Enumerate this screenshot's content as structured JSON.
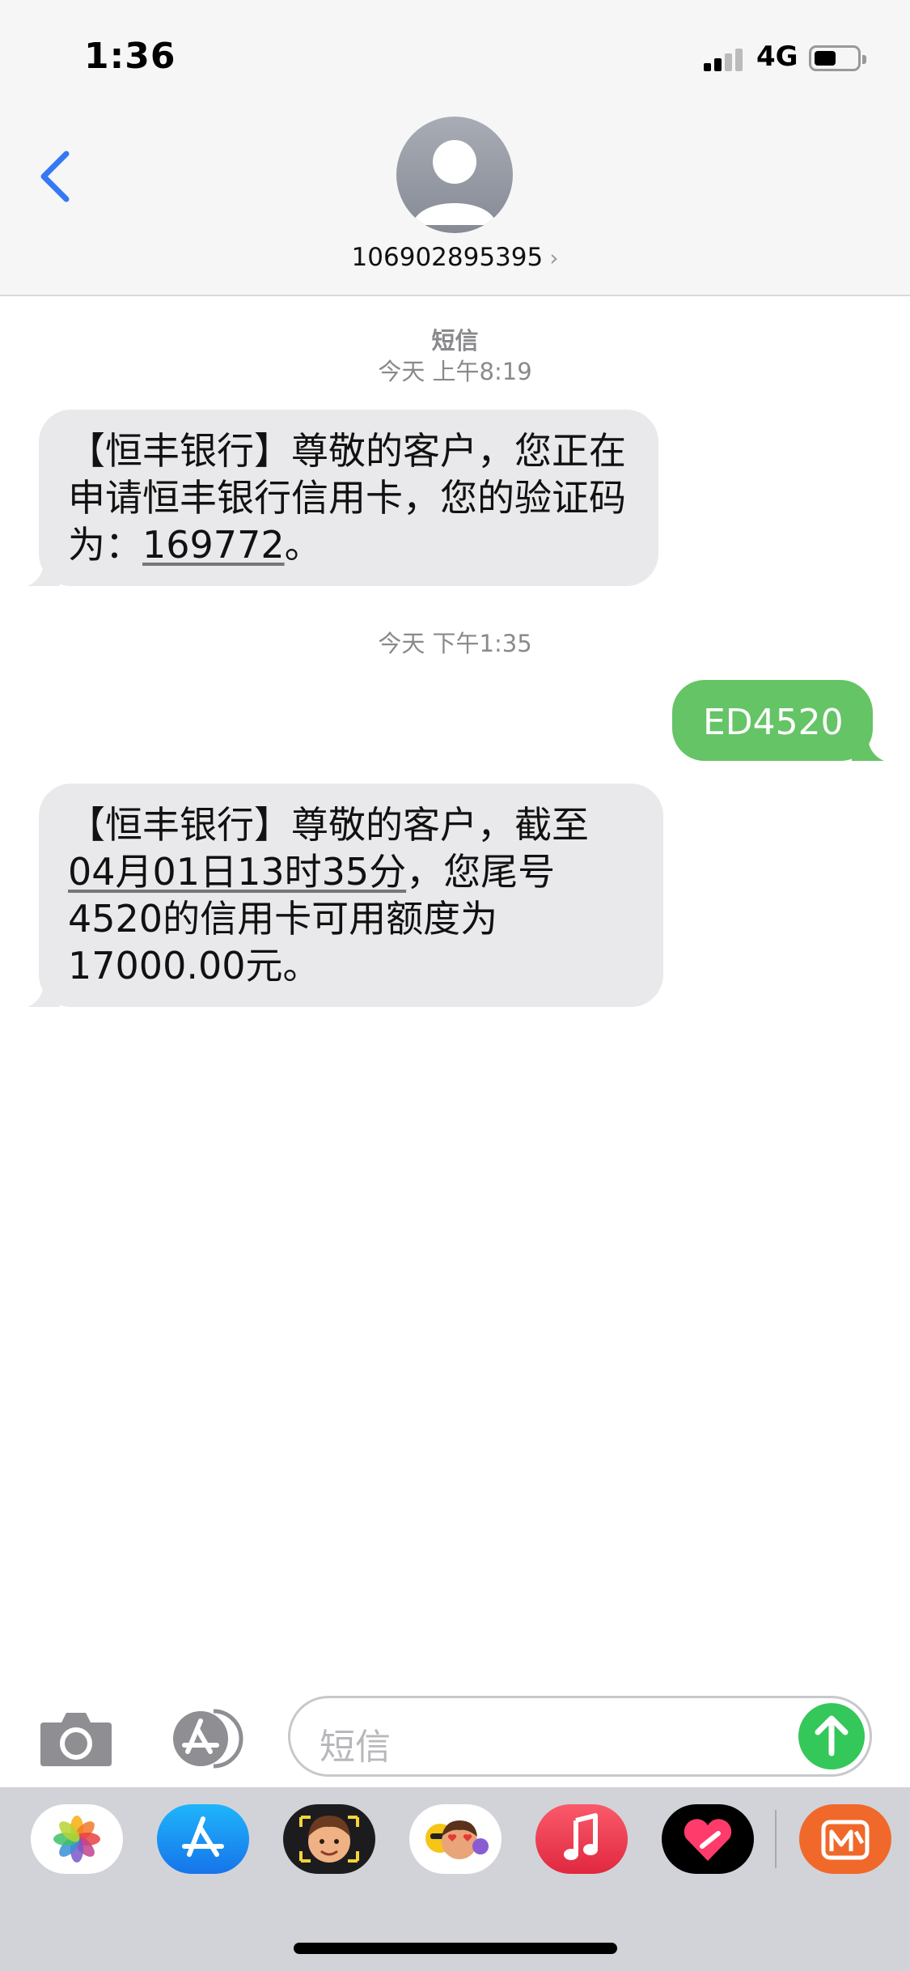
{
  "status_bar": {
    "time": "1:36",
    "network": "4G"
  },
  "header": {
    "contact_number": "106902895395",
    "chevron": "›"
  },
  "conversation": {
    "service_label": "短信",
    "time_1": "今天 上午8:19",
    "msg_1": {
      "prefix": "【恒丰银行】尊敬的客户，您正在申请恒丰银行信用卡，您的验证码为：",
      "code": "169772",
      "suffix": "。"
    },
    "time_2": "今天 下午1:35",
    "msg_out": "ED4520",
    "msg_2": {
      "line1": "【恒丰银行】尊敬的客户，截至",
      "date": "04月01日13时35分",
      "after_date": "，您尾号",
      "line3": "4520的信用卡可用额度为",
      "line4": "17000.00元。"
    }
  },
  "input_bar": {
    "placeholder": "短信"
  },
  "app_drawer": {
    "apps": [
      "photos-app",
      "app-store-app",
      "memoji-app",
      "animoji-stickers-app",
      "music-app",
      "heart-app",
      "mango-tv-app"
    ]
  },
  "colors": {
    "incoming_bubble": "#e9e9eb",
    "outgoing_bubble": "#65c466",
    "accent_blue": "#3478f6",
    "send_green": "#34c759"
  }
}
